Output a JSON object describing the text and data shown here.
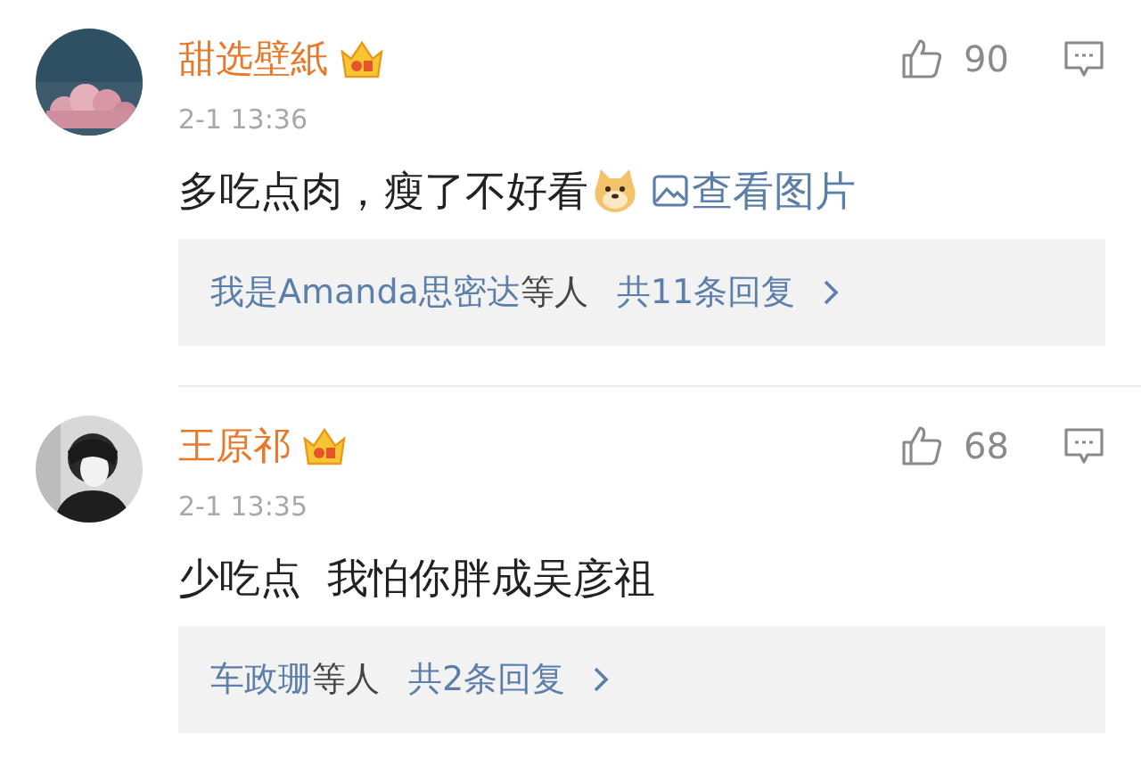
{
  "comments": [
    {
      "avatar": {
        "kind": "sky"
      },
      "username": "甜选壁紙",
      "badge": true,
      "likes": "90",
      "time": "2-1 13:36",
      "content": [
        {
          "kind": "text",
          "text": "多吃点肉，瘦了不好看"
        },
        {
          "kind": "emoji"
        },
        {
          "kind": "image_link",
          "text": "查看图片"
        }
      ],
      "replies": {
        "users": "我是Amanda思密达",
        "suffix": "等人",
        "count": "共11条回复"
      }
    },
    {
      "avatar": {
        "kind": "figure"
      },
      "username": "王原祁",
      "badge": true,
      "likes": "68",
      "time": "2-1 13:35",
      "content": [
        {
          "kind": "text",
          "text": "少吃点  我怕你胖成吴彦祖"
        }
      ],
      "replies": {
        "users": "车政珊",
        "suffix": "等人",
        "count": "共2条回复"
      }
    }
  ]
}
